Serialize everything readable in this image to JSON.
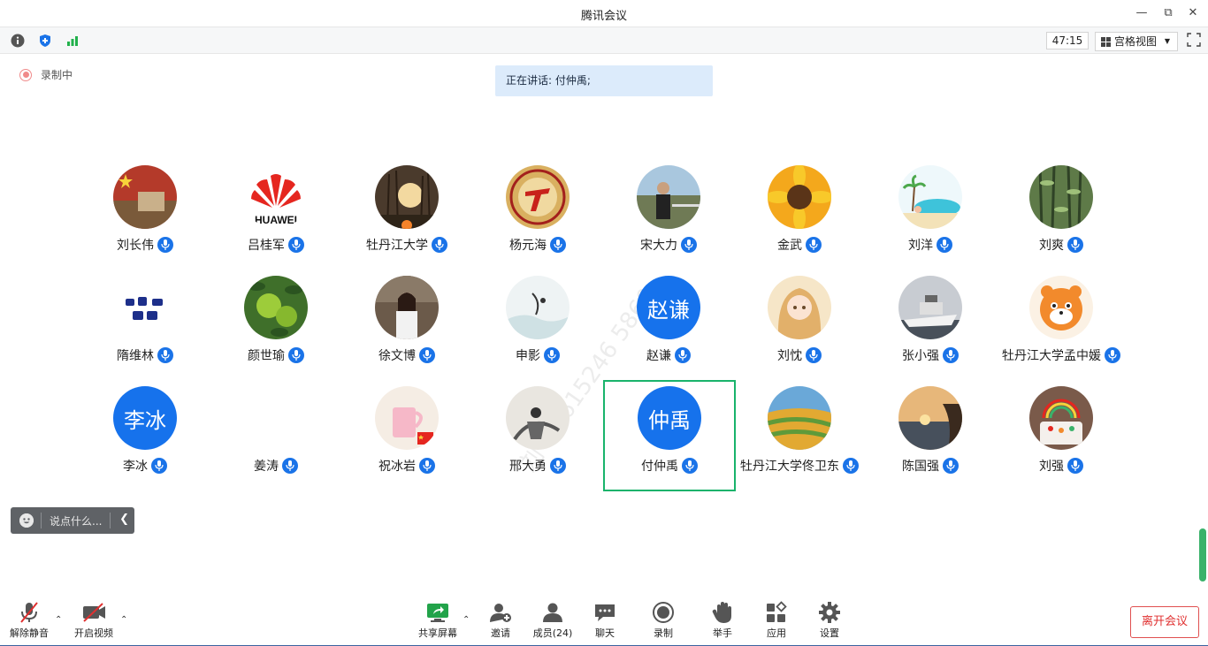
{
  "window": {
    "title": "腾讯会议"
  },
  "toolbar": {
    "timer": "47:15",
    "view_mode": "宫格视图"
  },
  "recording": {
    "label": "录制中"
  },
  "speaking": {
    "text": "正在讲话: 付仲禹;"
  },
  "participants": [
    {
      "name": "刘长伟",
      "avatar": "china-flag-building-icon"
    },
    {
      "name": "吕桂军",
      "avatar": "huawei-logo-icon"
    },
    {
      "name": "牡丹江大学",
      "avatar": "sunset-trees-icon"
    },
    {
      "name": "杨元海",
      "avatar": "university-badge-icon"
    },
    {
      "name": "宋大力",
      "avatar": "man-photo-icon"
    },
    {
      "name": "金武",
      "avatar": "sunflower-icon"
    },
    {
      "name": "刘洋",
      "avatar": "beach-illustration-icon"
    },
    {
      "name": "刘爽",
      "avatar": "bamboo-icon"
    },
    {
      "name": "隋维林",
      "avatar": "calligraphy-icon"
    },
    {
      "name": "颜世瑜",
      "avatar": "green-apples-icon"
    },
    {
      "name": "徐文博",
      "avatar": "girl-photo-icon"
    },
    {
      "name": "申影",
      "avatar": "ink-painting-icon"
    },
    {
      "name": "赵谦",
      "avatar_text": "赵谦"
    },
    {
      "name": "刘忱",
      "avatar": "anime-girl-icon"
    },
    {
      "name": "张小强",
      "avatar": "yacht-icon"
    },
    {
      "name": "牡丹江大学孟中媛",
      "avatar": "tiger-cartoon-icon"
    },
    {
      "name": "李冰",
      "avatar_text": "李冰"
    },
    {
      "name": "姜涛",
      "avatar": "none"
    },
    {
      "name": "祝冰岩",
      "avatar": "pink-cup-icon"
    },
    {
      "name": "邢大勇",
      "avatar": "ink-figure-icon"
    },
    {
      "name": "付仲禹",
      "avatar_text": "仲禹",
      "active": true
    },
    {
      "name": "牡丹江大学佟卫东",
      "avatar": "terraced-fields-icon"
    },
    {
      "name": "陈国强",
      "avatar": "sunset-sea-icon"
    },
    {
      "name": "刘强",
      "avatar": "rainbow-cake-icon"
    }
  ],
  "chat": {
    "placeholder": "说点什么..."
  },
  "bottombar": {
    "unmute": "解除静音",
    "video": "开启视频",
    "share": "共享屏幕",
    "invite": "邀请",
    "members": "成员(24)",
    "chat": "聊天",
    "record": "录制",
    "raise_hand": "举手",
    "apps": "应用",
    "settings": "设置",
    "leave": "离开会议"
  },
  "colors": {
    "accent": "#1a73e8",
    "active_border": "#19b36b",
    "leave": "#e03030"
  }
}
